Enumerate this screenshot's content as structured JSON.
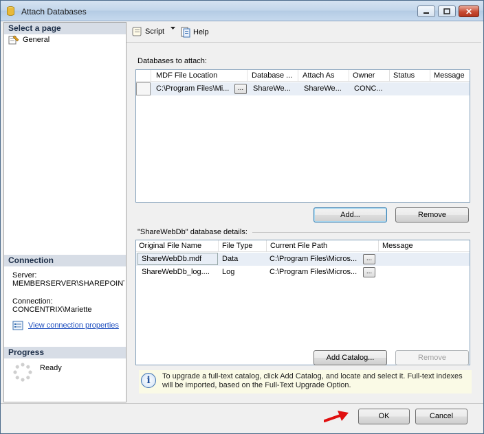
{
  "window": {
    "title": "Attach Databases"
  },
  "titlebar_buttons": {
    "minimize": "–",
    "maximize": "□",
    "close": "✕"
  },
  "left": {
    "select_page_header": "Select a page",
    "pages": [
      {
        "label": "General",
        "icon": "page-wrench-icon"
      }
    ],
    "connection_header": "Connection",
    "server_label": "Server:",
    "server_value": "MEMBERSERVER\\SHAREPOINT",
    "connection_label": "Connection:",
    "connection_value": "CONCENTRIX\\Mariette",
    "view_props_link": "View connection properties",
    "progress_header": "Progress",
    "progress_status": "Ready"
  },
  "toolbar": {
    "script_label": "Script",
    "help_label": "Help"
  },
  "attach": {
    "section_label": "Databases to attach:",
    "columns": [
      "MDF File Location",
      "Database ...",
      "Attach As",
      "Owner",
      "Status",
      "Message"
    ],
    "rows": [
      {
        "mdf": "C:\\Program Files\\Mi...",
        "database": "ShareWe...",
        "attach_as": "ShareWe...",
        "owner": "CONC...",
        "status": "",
        "message": ""
      }
    ],
    "browse_label": "...",
    "add_label": "Add...",
    "remove_label": "Remove"
  },
  "details": {
    "section_label": "\"ShareWebDb\" database details:",
    "columns": [
      "Original File Name",
      "File Type",
      "Current File Path",
      "Message"
    ],
    "rows": [
      {
        "name": "ShareWebDb.mdf",
        "type": "Data",
        "path": "C:\\Program Files\\Micros...",
        "message": ""
      },
      {
        "name": "ShareWebDb_log....",
        "type": "Log",
        "path": "C:\\Program Files\\Micros...",
        "message": ""
      }
    ],
    "browse_label": "...",
    "add_catalog_label": "Add Catalog...",
    "remove_label": "Remove"
  },
  "info": {
    "icon": "info-icon",
    "text": "To upgrade a full-text catalog, click Add Catalog, and locate and select it. Full-text indexes will be imported, based on the Full-Text Upgrade Option."
  },
  "footer": {
    "ok_label": "OK",
    "cancel_label": "Cancel"
  },
  "colors": {
    "accent": "#1f4fbf",
    "section_header_bg": "#d7dde6",
    "arrow": "#e01010"
  }
}
